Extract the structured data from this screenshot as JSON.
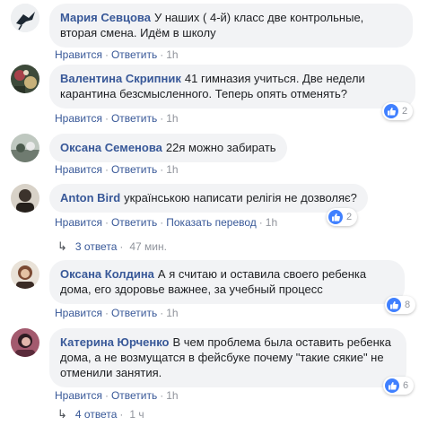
{
  "comments": [
    {
      "author": "Мария Севцова",
      "text": "У наших ( 4-й) класс две контрольные, вторая смена. Идём в школу",
      "like": "Нравится",
      "reply": "Ответить",
      "time": "1h"
    },
    {
      "author": "Валентина Скрипник",
      "text": "41 гимназия учиться. Две недели карантина безсмысленного. Теперь опять отменять?",
      "like": "Нравится",
      "reply": "Ответить",
      "time": "1h",
      "reactions": "2"
    },
    {
      "author": "Оксана Семенова",
      "text": "22я можно забирать",
      "like": "Нравится",
      "reply": "Ответить",
      "time": "1h"
    },
    {
      "author": "Anton Bird",
      "text": "українською написати релігія не дозволяє?",
      "like": "Нравится",
      "reply": "Ответить",
      "translate": "Показать перевод",
      "time": "1h",
      "reactions": "2",
      "replies": "3 ответа",
      "replies_time": "47 мин."
    },
    {
      "author": "Оксана Колдина",
      "text": "А я считаю и оставила своего ребенка дома, его здоровье важнее, за учебный процесс",
      "like": "Нравится",
      "reply": "Ответить",
      "time": "1h",
      "reactions": "8"
    },
    {
      "author": "Катерина Юрченко",
      "text": "В чем проблема была оставить ребенка дома, а не возмущатся в фейсбуке почему \"такие сякие\" не отменили занятия.",
      "like": "Нравится",
      "reply": "Ответить",
      "time": "1h",
      "reactions": "6",
      "replies": "4 ответа",
      "replies_time": "1 ч"
    }
  ],
  "colors": {
    "link": "#385898",
    "meta": "#90949c",
    "bubble": "#f2f3f5",
    "like": "#4080ff"
  },
  "icons": {
    "like": "thumbs-up-icon",
    "reply_arrow": "reply-arrow-icon"
  }
}
